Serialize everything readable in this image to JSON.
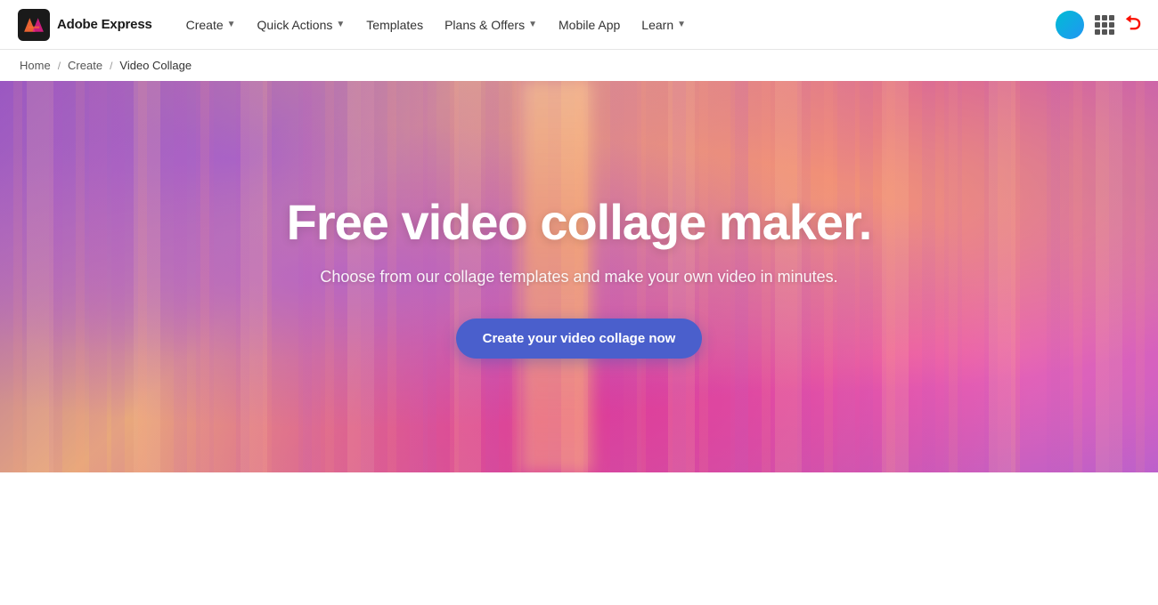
{
  "nav": {
    "logo_text": "Adobe Express",
    "links": [
      {
        "label": "Create",
        "has_dropdown": true
      },
      {
        "label": "Quick Actions",
        "has_dropdown": true
      },
      {
        "label": "Templates",
        "has_dropdown": false
      },
      {
        "label": "Plans & Offers",
        "has_dropdown": true
      },
      {
        "label": "Mobile App",
        "has_dropdown": false
      },
      {
        "label": "Learn",
        "has_dropdown": true
      }
    ]
  },
  "breadcrumb": {
    "home": "Home",
    "sep1": "/",
    "create": "Create",
    "sep2": "/",
    "current": "Video Collage"
  },
  "hero": {
    "title": "Free video collage maker.",
    "subtitle": "Choose from our collage templates and make your own video in minutes.",
    "cta_label": "Create your video collage now"
  }
}
